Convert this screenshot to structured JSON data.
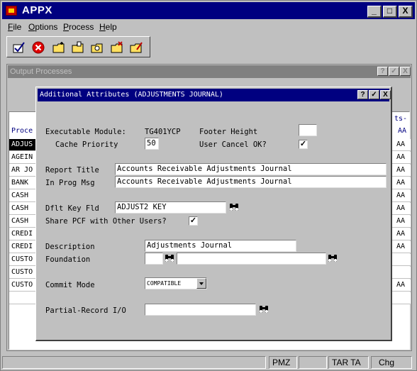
{
  "window": {
    "title": "APPX",
    "minimize": "_",
    "maximize": "□",
    "close": "X"
  },
  "menu": [
    {
      "underline": "F",
      "rest": "ile"
    },
    {
      "underline": "O",
      "rest": "ptions"
    },
    {
      "underline": "P",
      "rest": "rocess"
    },
    {
      "underline": "H",
      "rest": "elp"
    }
  ],
  "toolbar": {
    "icons": [
      "ok-check-icon",
      "cancel-icon",
      "new-folder-icon",
      "open-folder-icon",
      "search-folder-icon",
      "delete-folder-icon",
      "edit-folder-icon"
    ]
  },
  "output_window": {
    "title": "Output Processes",
    "help": "?",
    "ok": "✓",
    "close": "X",
    "column_header_left": "Proce",
    "column_header_right_1": "ts-",
    "column_header_right_2": "AA",
    "rows_left": [
      "ADJUS",
      "AGEIN",
      "AR JO",
      "BANK",
      "CASH",
      "CASH",
      "CASH",
      "CREDI",
      "CREDI",
      "CUSTO",
      "CUSTO",
      "CUSTO",
      ""
    ],
    "rows_right": [
      "AA",
      "AA",
      "AA",
      "AA",
      "AA",
      "AA",
      "AA",
      "AA",
      "AA",
      "",
      "",
      "AA",
      ""
    ]
  },
  "dialog": {
    "title": "Additional Attributes (ADJUSTMENTS JOURNAL)",
    "help": "?",
    "ok": "✓",
    "close": "X",
    "executable_module_label": "Executable Module:",
    "executable_module_value": "TG401YCP",
    "footer_height_label": "Footer Height",
    "footer_height_value": "",
    "cache_priority_label": "Cache Priority",
    "cache_priority_value": "50",
    "user_cancel_label": "User Cancel OK?",
    "user_cancel_checked": "✓",
    "report_title_label": "Report Title",
    "report_title_value": "Accounts Receivable Adjustments Journal",
    "in_prog_msg_label": "In Prog Msg",
    "in_prog_msg_value": "Accounts Receivable Adjustments Journal",
    "dflt_key_fld_label": "Dflt Key Fld",
    "dflt_key_fld_value": "ADJUST2 KEY",
    "share_pcf_label": "Share PCF with Other Users?",
    "share_pcf_checked": "✓",
    "description_label": "Description",
    "description_value": "Adjustments Journal",
    "foundation_label": "Foundation",
    "foundation_value_1": "",
    "foundation_value_2": "",
    "commit_mode_label": "Commit Mode",
    "commit_mode_value": "COMPATIBLE",
    "partial_record_label": "Partial-Record I/O",
    "partial_record_value": ""
  },
  "status": {
    "p1": "",
    "p2": "",
    "p3": "PMZ",
    "p4": "",
    "p5": "TAR TA",
    "p6": "Chg"
  }
}
